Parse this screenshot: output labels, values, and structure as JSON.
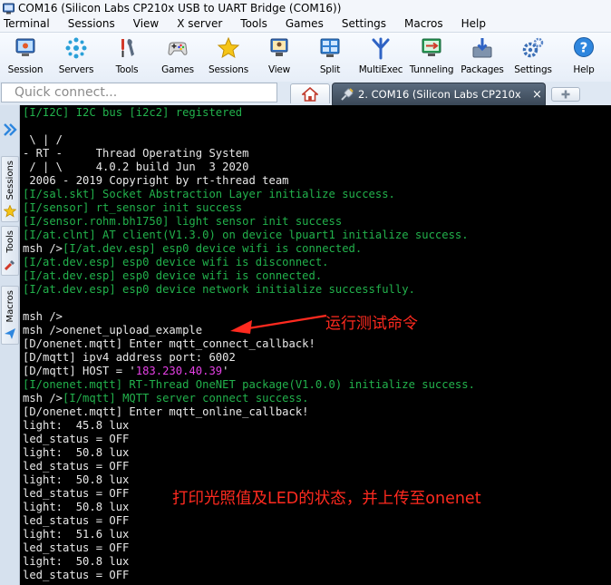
{
  "window": {
    "title": "COM16  (Silicon Labs CP210x USB to UART Bridge (COM16))"
  },
  "menu": [
    "Terminal",
    "Sessions",
    "View",
    "X server",
    "Tools",
    "Games",
    "Settings",
    "Macros",
    "Help"
  ],
  "toolbar": [
    {
      "label": "Session",
      "icon": "session-icon"
    },
    {
      "label": "Servers",
      "icon": "servers-icon"
    },
    {
      "label": "Tools",
      "icon": "tools-icon"
    },
    {
      "label": "Games",
      "icon": "games-icon"
    },
    {
      "label": "Sessions",
      "icon": "star-icon"
    },
    {
      "label": "View",
      "icon": "view-icon"
    },
    {
      "label": "Split",
      "icon": "split-icon"
    },
    {
      "label": "MultiExec",
      "icon": "multiexec-icon"
    },
    {
      "label": "Tunneling",
      "icon": "tunneling-icon"
    },
    {
      "label": "Packages",
      "icon": "packages-icon"
    },
    {
      "label": "Settings",
      "icon": "gear-icon"
    },
    {
      "label": "Help",
      "icon": "help-icon"
    }
  ],
  "quick_connect": {
    "placeholder": "Quick connect..."
  },
  "tabs": {
    "active_label": "2. COM16  (Silicon Labs CP210x USB",
    "close_glyph": "×"
  },
  "sidebar": {
    "tabs": [
      "Sessions",
      "Tools",
      "Macros"
    ]
  },
  "terminal": {
    "lines": [
      {
        "text": "[I/I2C] I2C bus [i2c2] registered",
        "color": "green"
      },
      {
        "text": "",
        "color": "white"
      },
      {
        "text": " \\ | /",
        "color": "white"
      },
      {
        "text": "- RT -     Thread Operating System",
        "color": "white"
      },
      {
        "text": " / | \\     4.0.2 build Jun  3 2020",
        "color": "white"
      },
      {
        "text": " 2006 - 2019 Copyright by rt-thread team",
        "color": "white"
      },
      {
        "text": "[I/sal.skt] Socket Abstraction Layer initialize success.",
        "color": "green"
      },
      {
        "text": "[I/sensor] rt_sensor init success",
        "color": "green"
      },
      {
        "text": "[I/sensor.rohm.bh1750] light sensor init success",
        "color": "green"
      },
      {
        "text": "[I/at.clnt] AT client(V1.3.0) on device lpuart1 initialize success.",
        "color": "green"
      },
      {
        "text": "msh />",
        "suffix": "[I/at.dev.esp] esp0 device wifi is connected.",
        "color": "white",
        "suffix_color": "green"
      },
      {
        "text": "[I/at.dev.esp] esp0 device wifi is disconnect.",
        "color": "green"
      },
      {
        "text": "[I/at.dev.esp] esp0 device wifi is connected.",
        "color": "green"
      },
      {
        "text": "[I/at.dev.esp] esp0 device network initialize successfully.",
        "color": "green"
      },
      {
        "text": "",
        "color": "white"
      },
      {
        "text": "msh />",
        "color": "white"
      },
      {
        "text": "msh />onenet_upload_example",
        "color": "white"
      },
      {
        "text": "[D/onenet.mqtt] Enter mqtt_connect_callback!",
        "color": "white"
      },
      {
        "text": "[D/mqtt] ipv4 address port: 6002",
        "color": "white"
      },
      {
        "text": "[D/mqtt] HOST = '",
        "mid": "183.230.40.39",
        "end": "'",
        "color": "white",
        "mid_color": "magenta"
      },
      {
        "text": "[I/onenet.mqtt] RT-Thread OneNET package(V1.0.0) initialize success.",
        "color": "green"
      },
      {
        "text": "msh />",
        "suffix": "[I/mqtt] MQTT server connect success.",
        "color": "white",
        "suffix_color": "green"
      },
      {
        "text": "[D/onenet.mqtt] Enter mqtt_online_callback!",
        "color": "white"
      },
      {
        "text": "light:  45.8 lux",
        "color": "white"
      },
      {
        "text": "led_status = OFF",
        "color": "white"
      },
      {
        "text": "light:  50.8 lux",
        "color": "white"
      },
      {
        "text": "led_status = OFF",
        "color": "white"
      },
      {
        "text": "light:  50.8 lux",
        "color": "white"
      },
      {
        "text": "led_status = OFF",
        "color": "white"
      },
      {
        "text": "light:  50.8 lux",
        "color": "white"
      },
      {
        "text": "led_status = OFF",
        "color": "white"
      },
      {
        "text": "light:  51.6 lux",
        "color": "white"
      },
      {
        "text": "led_status = OFF",
        "color": "white"
      },
      {
        "text": "light:  50.8 lux",
        "color": "white"
      },
      {
        "text": "led_status = OFF",
        "color": "white"
      }
    ],
    "annotation_run": "运行测试命令",
    "annotation_print": "打印光照值及LED的状态，并上传至onenet"
  },
  "colors": {
    "terminal_bg": "#000000",
    "green_text": "#22b24c",
    "white_text": "#e8e8e8",
    "magenta_text": "#e640e6",
    "annotation": "#ff2a1f"
  }
}
